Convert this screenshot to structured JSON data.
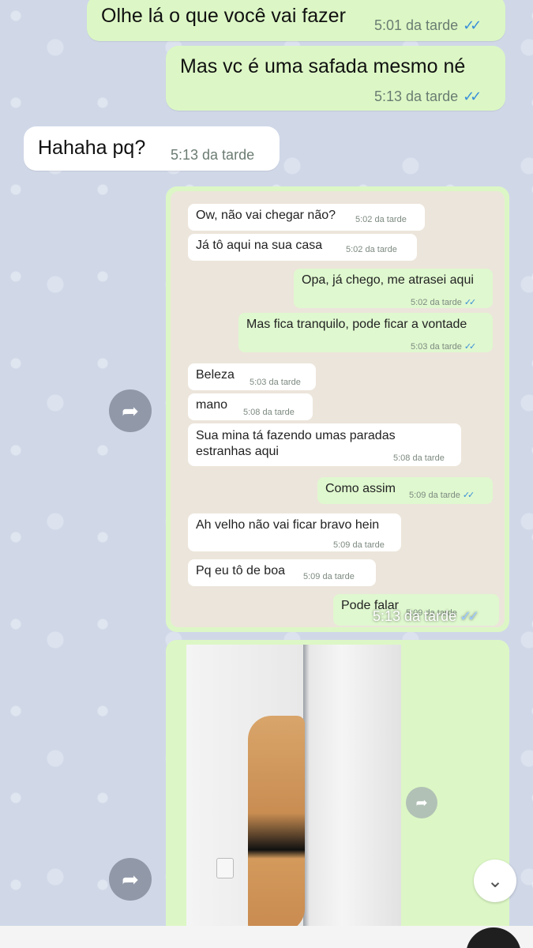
{
  "messages": [
    {
      "text": "Olhe lá o que você vai fazer",
      "time": "5:01 da tarde",
      "ticks": "✓✓"
    },
    {
      "text": "Mas vc é uma safada mesmo né",
      "time": "5:13 da tarde",
      "ticks": "✓✓"
    },
    {
      "text": "Hahaha pq?",
      "time": "5:13 da tarde"
    }
  ],
  "screenshot": {
    "messages": [
      {
        "text": "Ow, não vai chegar não?",
        "time": "5:02 da tarde"
      },
      {
        "text": "Já tô aqui na sua casa",
        "time": "5:02 da tarde"
      },
      {
        "text": "Opa, já chego, me atrasei aqui",
        "time": "5:02 da tarde",
        "ticks": "✓✓"
      },
      {
        "text": "Mas fica tranquilo, pode ficar a vontade",
        "time": "5:03 da tarde",
        "ticks": "✓✓"
      },
      {
        "text": "Beleza",
        "time": "5:03 da tarde"
      },
      {
        "text": "mano",
        "time": "5:08 da tarde"
      },
      {
        "text": "Sua mina tá fazendo umas paradas estranhas aqui",
        "time": "5:08 da tarde"
      },
      {
        "text": "Como assim",
        "time": "5:09 da tarde",
        "ticks": "✓✓"
      },
      {
        "text": "Ah velho não vai ficar bravo hein",
        "time": "5:09 da tarde"
      },
      {
        "text": "Pq eu tô de boa",
        "time": "5:09 da tarde"
      },
      {
        "text": "Pode falar",
        "time": "5:09 da tarde"
      }
    ],
    "overlay_time": "5:13 da tarde",
    "overlay_ticks": "✓✓"
  },
  "icons": {
    "forward": "forward-icon",
    "scroll_down": "double-chevron-down-icon"
  },
  "colors": {
    "outgoing": "#dcf7c5",
    "incoming": "#ffffff",
    "read_ticks": "#3a8ed8",
    "wallpaper": "#d0d8e8"
  }
}
